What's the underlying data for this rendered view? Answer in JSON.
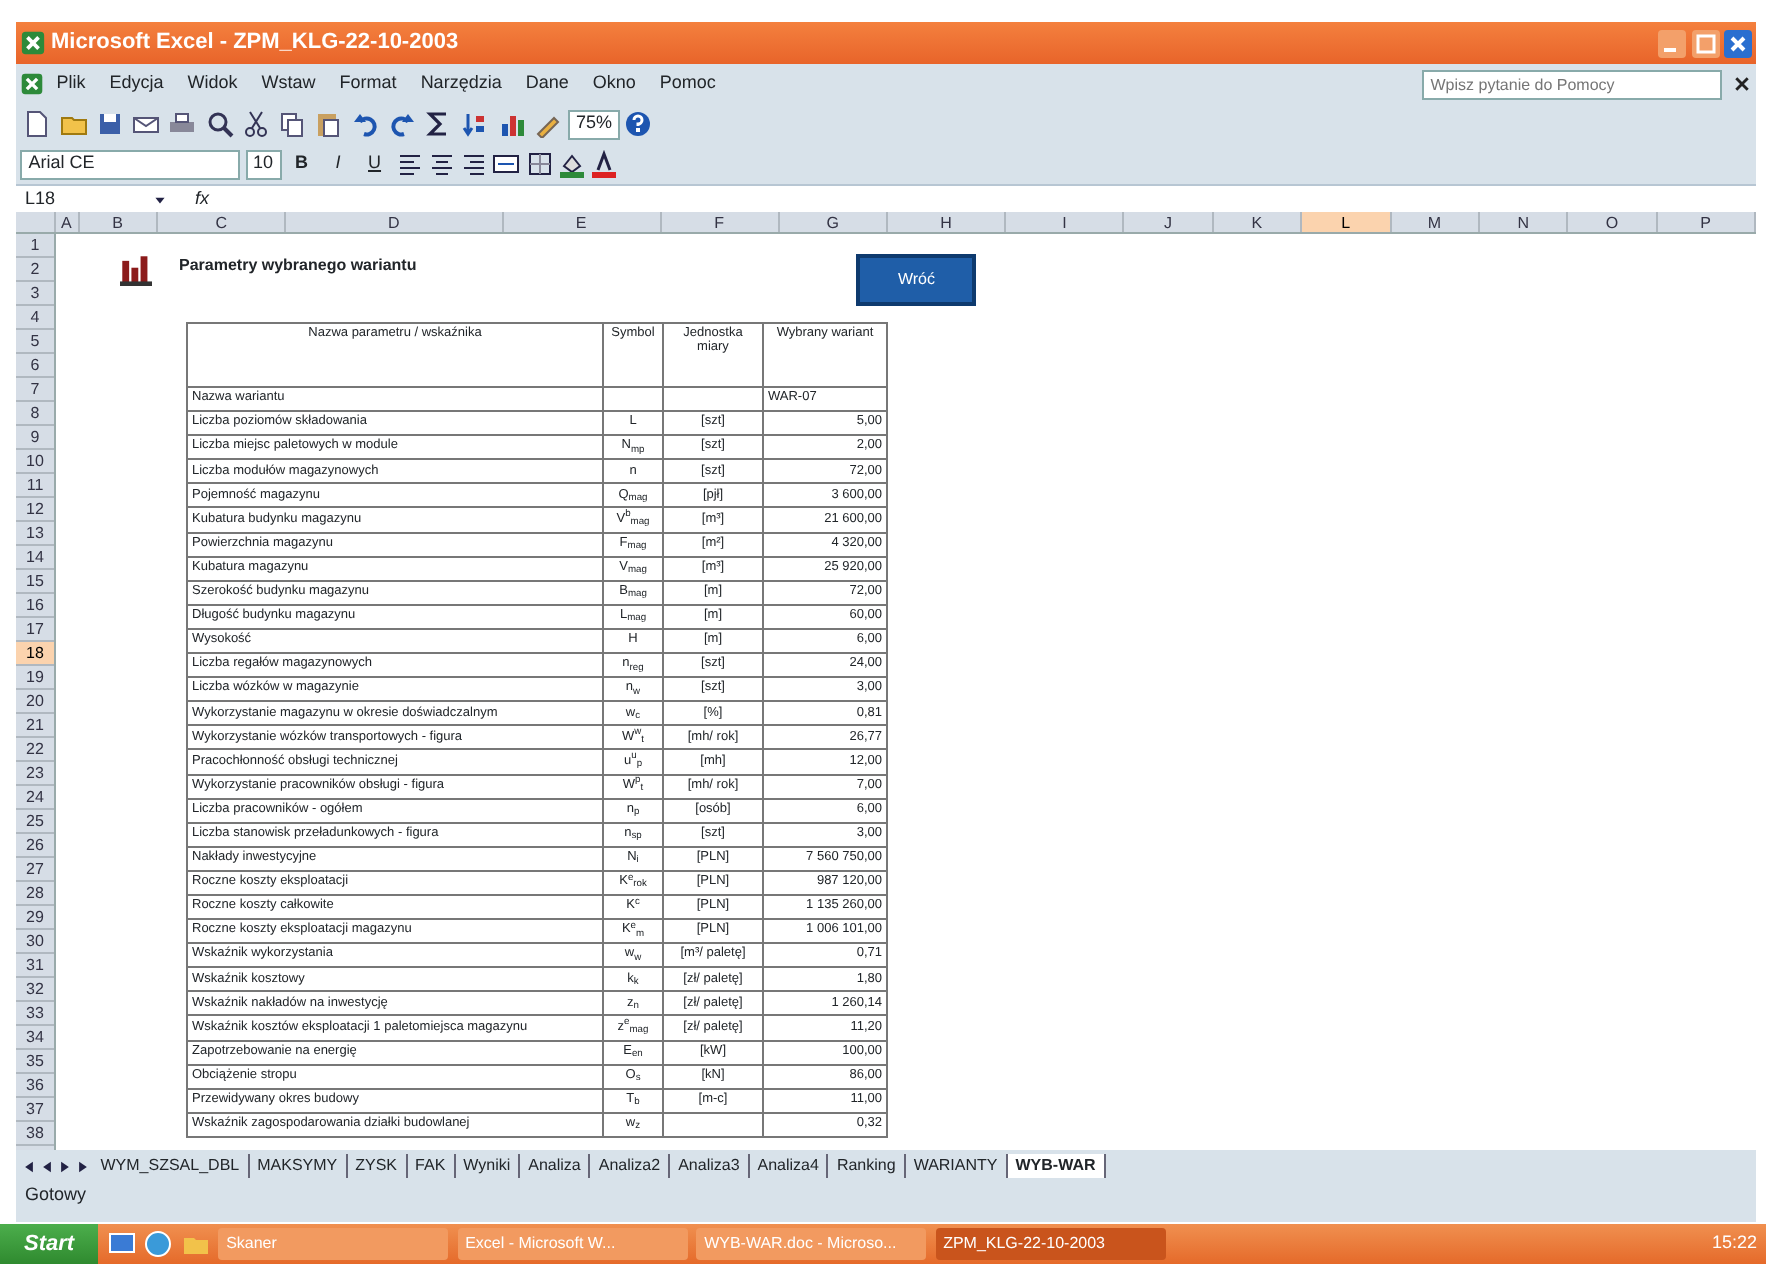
{
  "window": {
    "title": "Microsoft Excel - ZPM_KLG-22-10-2003"
  },
  "menu": [
    "Plik",
    "Edycja",
    "Widok",
    "Wstaw",
    "Format",
    "Narzędzia",
    "Dane",
    "Okno",
    "Pomoc"
  ],
  "help_search": {
    "placeholder": "Wpisz pytanie do Pomocy"
  },
  "toolbar": {
    "zoom": "75%",
    "font": "Arial CE",
    "font_size": "10",
    "format_buttons": [
      "B",
      "I",
      "U"
    ]
  },
  "formula_bar": {
    "cell": "L18",
    "fx": "fx"
  },
  "columns": [
    {
      "label": "A",
      "selected": false
    },
    {
      "label": "B",
      "selected": false
    },
    {
      "label": "C",
      "selected": false
    },
    {
      "label": "D",
      "selected": false
    },
    {
      "label": "E",
      "selected": false
    },
    {
      "label": "F",
      "selected": false
    },
    {
      "label": "G",
      "selected": false
    },
    {
      "label": "H",
      "selected": false
    },
    {
      "label": "I",
      "selected": false
    },
    {
      "label": "J",
      "selected": false
    },
    {
      "label": "K",
      "selected": false
    },
    {
      "label": "L",
      "selected": true
    },
    {
      "label": "M",
      "selected": false
    },
    {
      "label": "N",
      "selected": false
    },
    {
      "label": "O",
      "selected": false
    },
    {
      "label": "P",
      "selected": false
    }
  ],
  "row_numbers": [
    {
      "label": "1",
      "selected": false
    },
    {
      "label": "2",
      "selected": false
    },
    {
      "label": "3",
      "selected": false
    },
    {
      "label": "4",
      "selected": false
    },
    {
      "label": "5",
      "selected": false
    },
    {
      "label": "6",
      "selected": false
    },
    {
      "label": "7",
      "selected": false
    },
    {
      "label": "8",
      "selected": false
    },
    {
      "label": "9",
      "selected": false
    },
    {
      "label": "10",
      "selected": false
    },
    {
      "label": "11",
      "selected": false
    },
    {
      "label": "12",
      "selected": false
    },
    {
      "label": "13",
      "selected": false
    },
    {
      "label": "14",
      "selected": false
    },
    {
      "label": "15",
      "selected": false
    },
    {
      "label": "16",
      "selected": false
    },
    {
      "label": "17",
      "selected": false
    },
    {
      "label": "18",
      "selected": true
    },
    {
      "label": "19",
      "selected": false
    },
    {
      "label": "20",
      "selected": false
    },
    {
      "label": "21",
      "selected": false
    },
    {
      "label": "22",
      "selected": false
    },
    {
      "label": "23",
      "selected": false
    },
    {
      "label": "24",
      "selected": false
    },
    {
      "label": "25",
      "selected": false
    },
    {
      "label": "26",
      "selected": false
    },
    {
      "label": "27",
      "selected": false
    },
    {
      "label": "28",
      "selected": false
    },
    {
      "label": "29",
      "selected": false
    },
    {
      "label": "30",
      "selected": false
    },
    {
      "label": "31",
      "selected": false
    },
    {
      "label": "32",
      "selected": false
    },
    {
      "label": "33",
      "selected": false
    },
    {
      "label": "34",
      "selected": false
    },
    {
      "label": "35",
      "selected": false
    },
    {
      "label": "36",
      "selected": false
    },
    {
      "label": "37",
      "selected": false
    },
    {
      "label": "38",
      "selected": false
    }
  ],
  "sheet": {
    "heading": "Parametry wybranego wariantu",
    "back_button": "Wróć",
    "table": {
      "columns": [
        "Nazwa parametru / wskaźnika",
        "Symbol",
        "Jednostka miary",
        "Wybrany wariant"
      ],
      "rows": [
        {
          "name": "Nazwa wariantu",
          "value": "WAR-07"
        },
        {
          "name": "Liczba poziomów składowania",
          "symbol": "L",
          "unit": "[szt]",
          "value": "5,00"
        },
        {
          "name": "Liczba miejsc paletowych w module",
          "symbol": "N$_{mp}$",
          "unit": "[szt]",
          "value": "2,00"
        },
        {
          "name": "Liczba modułów magazynowych",
          "symbol": "n",
          "unit": "[szt]",
          "value": "72,00"
        },
        {
          "name": "Pojemność magazynu",
          "symbol": "Q$_{mag}$",
          "unit": "[pjł]",
          "value": "3 600,00"
        },
        {
          "name": "Kubatura budynku magazynu",
          "symbol": "V$^{b}$$_{mag}$",
          "unit": "[m³]",
          "value": "21 600,00"
        },
        {
          "name": "Powierzchnia magazynu",
          "symbol": "F$_{mag}$",
          "unit": "[m²]",
          "value": "4 320,00"
        },
        {
          "name": "Kubatura magazynu",
          "symbol": "V$_{mag}$",
          "unit": "[m³]",
          "value": "25 920,00"
        },
        {
          "name": "Szerokość budynku magazynu",
          "symbol": "B$_{mag}$",
          "unit": "[m]",
          "value": "72,00"
        },
        {
          "name": "Długość budynku magazynu",
          "symbol": "L$_{mag}$",
          "unit": "[m]",
          "value": "60,00"
        },
        {
          "name": "Wysokość",
          "symbol": "H",
          "unit": "[m]",
          "value": "6,00"
        },
        {
          "name": "Liczba regałów magazynowych",
          "symbol": "n$_{reg}$",
          "unit": "[szt]",
          "value": "24,00"
        },
        {
          "name": "Liczba wózków w magazynie",
          "symbol": "n$_{w}$",
          "unit": "[szt]",
          "value": "3,00"
        },
        {
          "name": "Wykorzystanie magazynu w okresie doświadczalnym",
          "symbol": "w$_{c}$",
          "unit": "[%]",
          "value": "0,81"
        },
        {
          "name": "Wykorzystanie wózków transportowych - figura",
          "symbol": "W$^{w}$$_{t}$",
          "unit": "[mh/ rok]",
          "value": "26,77"
        },
        {
          "name": "Pracochłonność obsługi technicznej",
          "symbol": "u$^{u}$$_{p}$",
          "unit": "[mh]",
          "value": "12,00"
        },
        {
          "name": "Wykorzystanie pracowników obsługi - figura",
          "symbol": "W$^{p}$$_{t}$",
          "unit": "[mh/ rok]",
          "value": "7,00"
        },
        {
          "name": "Liczba pracowników - ogółem",
          "symbol": "n$_{p}$",
          "unit": "[osób]",
          "value": "6,00"
        },
        {
          "name": "Liczba stanowisk przeładunkowych - figura",
          "symbol": "n$_{sp}$",
          "unit": "[szt]",
          "value": "3,00"
        },
        {
          "name": "Nakłady inwestycyjne",
          "symbol": "N$_{i}$",
          "unit": "[PLN]",
          "value": "7 560 750,00"
        },
        {
          "name": "Roczne koszty eksploatacji",
          "symbol": "K$^{e}$$_{rok}$",
          "unit": "[PLN]",
          "value": "987 120,00"
        },
        {
          "name": "Roczne koszty całkowite",
          "symbol": "K$^{c}$",
          "unit": "[PLN]",
          "value": "1 135 260,00"
        },
        {
          "name": "Roczne koszty eksploatacji magazynu",
          "symbol": "K$^{e}$$_{m}$",
          "unit": "[PLN]",
          "value": "1 006 101,00"
        },
        {
          "name": "Wskaźnik wykorzystania",
          "symbol": "w$_{w}$",
          "unit": "[m³/ paletę]",
          "value": "0,71"
        },
        {
          "name": "Wskaźnik kosztowy",
          "symbol": "k$_{k}$",
          "unit": "[zł/ paletę]",
          "value": "1,80"
        },
        {
          "name": "Wskaźnik nakładów na inwestycję",
          "symbol": "z$_{n}$",
          "unit": "[zł/ paletę]",
          "value": "1 260,14"
        },
        {
          "name": "Wskaźnik kosztów eksploatacji 1 paletomiejsca magazynu",
          "symbol": "z$^{e}$$_{mag}$",
          "unit": "[zł/ paletę]",
          "value": "11,20"
        },
        {
          "name": "Zapotrzebowanie na energię",
          "symbol": "E$_{en}$",
          "unit": "[kW]",
          "value": "100,00"
        },
        {
          "name": "Obciążenie stropu",
          "symbol": "O$_{s}$",
          "unit": "[kN]",
          "value": "86,00"
        },
        {
          "name": "Przewidywany okres budowy",
          "symbol": "T$_{b}$",
          "unit": "[m-c]",
          "value": "11,00"
        },
        {
          "name": "Wskaźnik zagospodarowania działki budowlanej",
          "symbol": "w$_{z}$",
          "value": "0,32"
        }
      ]
    }
  },
  "sheet_tabs": [
    {
      "label": "WYM_SZSAL_DBL",
      "selected": false
    },
    {
      "label": "MAKSYMY",
      "selected": false
    },
    {
      "label": "ZYSK",
      "selected": false
    },
    {
      "label": "FAK",
      "selected": false
    },
    {
      "label": "Wyniki",
      "selected": false
    },
    {
      "label": "Analiza",
      "selected": false
    },
    {
      "label": "Analiza2",
      "selected": false
    },
    {
      "label": "Analiza3",
      "selected": false
    },
    {
      "label": "Analiza4",
      "selected": false
    },
    {
      "label": "Ranking",
      "selected": false
    },
    {
      "label": "WARIANTY",
      "selected": false
    },
    {
      "label": "WYB-WAR",
      "selected": true
    }
  ],
  "status_bar": "Gotowy",
  "taskbar": {
    "start": "Start",
    "tasks": [
      {
        "label": "Skaner",
        "selected": false
      },
      {
        "label": "Excel - Microsoft W...",
        "selected": false
      },
      {
        "label": "WYB-WAR.doc - Microso...",
        "selected": false
      },
      {
        "label": "ZPM_KLG-22-10-2003",
        "selected": true
      }
    ],
    "clock": "15:22"
  }
}
